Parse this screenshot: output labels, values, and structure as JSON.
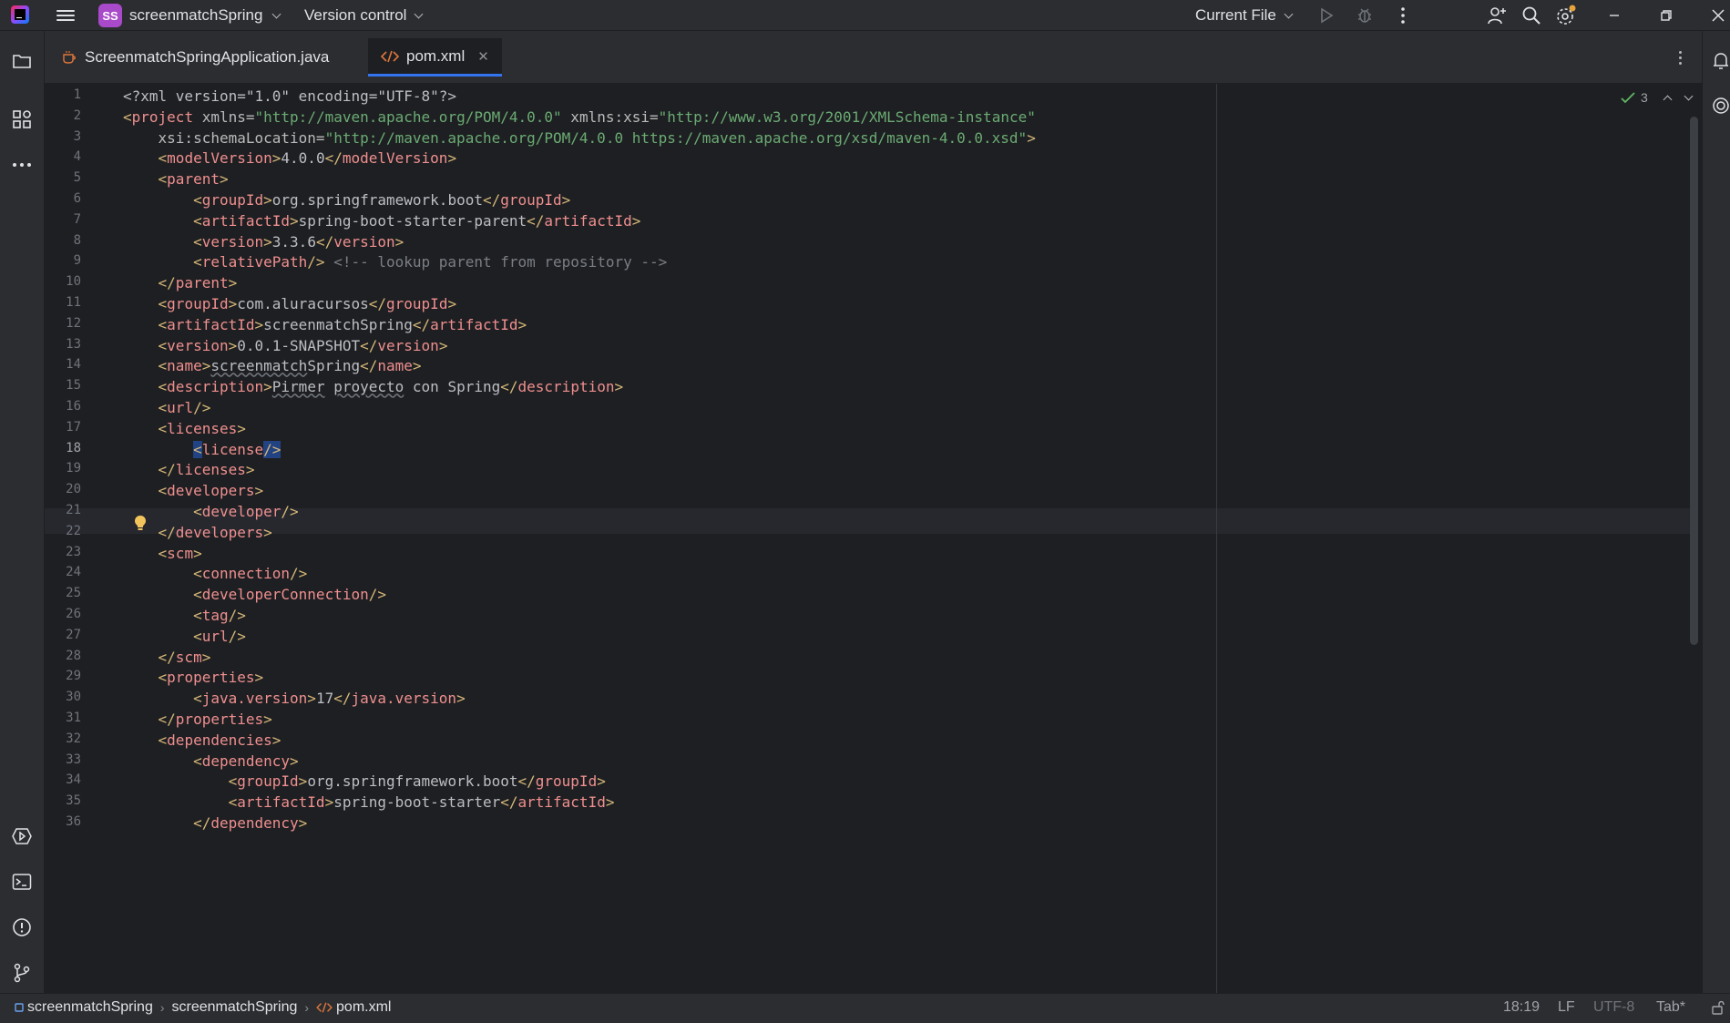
{
  "titlebar": {
    "project_badge": "SS",
    "project_name": "screenmatchSpring",
    "version_control": "Version control",
    "run_config": "Current File"
  },
  "tabs": [
    {
      "label": "ScreenmatchSpringApplication.java",
      "icon": "java-class-icon"
    },
    {
      "label": "pom.xml",
      "icon": "xml-file-icon",
      "active": true
    }
  ],
  "editor": {
    "inspection_count": "3",
    "current_line": 18
  },
  "code": {
    "line_numbers": [
      "1",
      "2",
      "3",
      "4",
      "5",
      "6",
      "7",
      "8",
      "9",
      "10",
      "11",
      "12",
      "13",
      "14",
      "15",
      "16",
      "17",
      "18",
      "19",
      "20",
      "21",
      "22",
      "23",
      "24",
      "25",
      "26",
      "27",
      "28",
      "29",
      "30",
      "31",
      "32",
      "33",
      "34",
      "35",
      "36"
    ],
    "l1": {
      "decl": "<?xml version=\"1.0\" encoding=\"UTF-8\"?>"
    },
    "l2": {
      "open": "<",
      "tag": "project",
      "a1": " xmlns",
      "eq1": "=",
      "v1": "\"http://maven.apache.org/POM/4.0.0\"",
      "a2": " xmlns:xsi",
      "eq2": "=",
      "v2": "\"http://www.w3.org/2001/XMLSchema-instance\""
    },
    "l3": {
      "a": "xsi:schemaLocation",
      "eq": "=",
      "v": "\"http://maven.apache.org/POM/4.0.0 https://maven.apache.org/xsd/maven-4.0.0.xsd\"",
      "close": ">"
    },
    "l4": {
      "tag": "modelVersion",
      "text": "4.0.0"
    },
    "l5": {
      "tag": "parent"
    },
    "l6": {
      "tag": "groupId",
      "text": "org.springframework.boot"
    },
    "l7": {
      "tag": "artifactId",
      "text": "spring-boot-starter-parent"
    },
    "l8": {
      "tag": "version",
      "text": "3.3.6"
    },
    "l9": {
      "tag": "relativePath",
      "comment": "<!-- lookup parent from repository -->"
    },
    "l10": {
      "tag": "parent"
    },
    "l11": {
      "tag": "groupId",
      "text": "com.aluracursos"
    },
    "l12": {
      "tag": "artifactId",
      "text": "screenmatchSpring"
    },
    "l13": {
      "tag": "version",
      "text": "0.0.1-SNAPSHOT"
    },
    "l14": {
      "tag": "name",
      "text_a": "screenmatch",
      "text_b": "Spring"
    },
    "l15": {
      "tag": "description",
      "text_a": "Pirmer",
      "text_b": "proyecto",
      "text_c": " con Spring"
    },
    "l16": {
      "tag": "url"
    },
    "l17": {
      "tag": "licenses"
    },
    "l18": {
      "tag": "license"
    },
    "l19": {
      "tag": "licenses"
    },
    "l20": {
      "tag": "developers"
    },
    "l21": {
      "tag": "developer"
    },
    "l22": {
      "tag": "developers"
    },
    "l23": {
      "tag": "scm"
    },
    "l24": {
      "tag": "connection"
    },
    "l25": {
      "tag": "developerConnection"
    },
    "l26": {
      "tag": "tag"
    },
    "l27": {
      "tag": "url"
    },
    "l28": {
      "tag": "scm"
    },
    "l29": {
      "tag": "properties"
    },
    "l30": {
      "tag": "java.version",
      "text": "17"
    },
    "l31": {
      "tag": "properties"
    },
    "l32": {
      "tag": "dependencies"
    },
    "l33": {
      "tag": "dependency"
    },
    "l34": {
      "tag": "groupId",
      "text": "org.springframework.boot"
    },
    "l35": {
      "tag": "artifactId",
      "text": "spring-boot-starter"
    },
    "l36": {
      "tag": "dependency"
    }
  },
  "statusbar": {
    "breadcrumbs": [
      "screenmatchSpring",
      "screenmatchSpring",
      "pom.xml"
    ],
    "caret": "18:19",
    "line_sep": "LF",
    "encoding": "UTF-8",
    "indent": "Tab*"
  },
  "colors": {
    "accent": "#3574f0",
    "project_badge": "#a84ac9",
    "tag_name": "#ef8f8f",
    "attr_value": "#6aab73"
  }
}
